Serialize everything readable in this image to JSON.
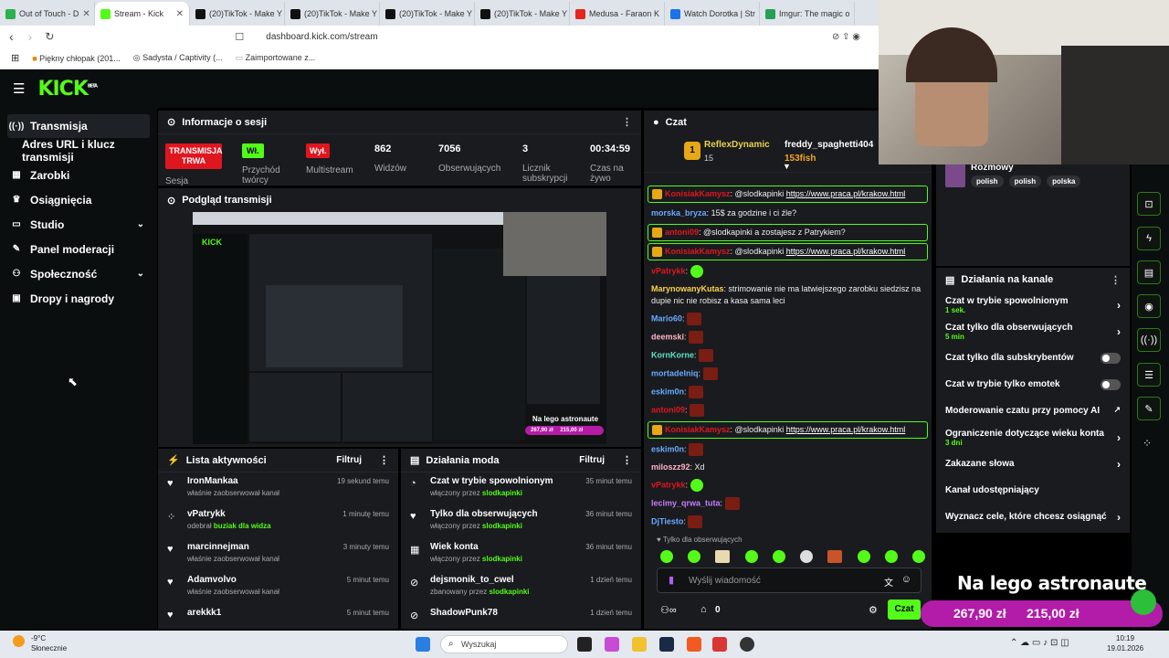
{
  "browser": {
    "tabs": [
      {
        "label": "Out of Touch - D",
        "color": "#2bb24c"
      },
      {
        "label": "Stream - Kick",
        "color": "#53fc18"
      },
      {
        "label": "(20)TikTok - Make Y",
        "color": "#111111"
      },
      {
        "label": "(20)TikTok - Make Y",
        "color": "#111111"
      },
      {
        "label": "(20)TikTok - Make Y",
        "color": "#111111"
      },
      {
        "label": "(20)TikTok - Make Y",
        "color": "#111111"
      },
      {
        "label": "Medusa - Faraon K",
        "color": "#e3261f"
      },
      {
        "label": "Watch Dorotka | Str",
        "color": "#1a73e8"
      },
      {
        "label": "Imgur: The magic o",
        "color": "#25a055"
      }
    ],
    "url": "dashboard.kick.com/stream",
    "bookmarks": [
      "Piękny chłopak (201...",
      "Sadysta / Captivity (...",
      "Zaimportowane z..."
    ]
  },
  "sidebar": {
    "items": [
      {
        "label": "Transmisja",
        "icon": "broadcast-icon"
      },
      {
        "label": "Adres URL i klucz transmisji",
        "icon": ""
      },
      {
        "label": "Zarobki",
        "icon": "chart-icon"
      },
      {
        "label": "Osiągnięcia",
        "icon": "trophy-icon"
      },
      {
        "label": "Studio",
        "icon": "studio-icon"
      },
      {
        "label": "Panel moderacji",
        "icon": "wrench-icon"
      },
      {
        "label": "Społeczność",
        "icon": "people-icon"
      },
      {
        "label": "Dropy i nagrody",
        "icon": "gift-icon"
      }
    ]
  },
  "session": {
    "title": "Informacje o sesji",
    "status_badge": "TRANSMISJA TRWA",
    "session_label": "Sesja",
    "forward_badge": "Wł.",
    "forward_label": "Przychód twórcy",
    "multistream_badge": "Wył.",
    "multistream_label": "Multistream",
    "viewers_value": "862",
    "viewers_label": "Widzów",
    "followers_value": "7056",
    "followers_label": "Obserwujących",
    "subs_value": "3",
    "subs_label": "Licznik subskrypcji",
    "time_value": "00:34:59",
    "time_label": "Czas na żywo"
  },
  "preview": {
    "title": "Podgląd transmisji",
    "overlay_text": "Na lego astronaute",
    "overlay_amount1": "267,90 zł",
    "overlay_amount2": "215,00 zł"
  },
  "activity": {
    "title": "Lista aktywności",
    "filter": "Filtruj",
    "rows": [
      {
        "name": "IronMankaa",
        "sub": "właśnie zaobserwował kanał",
        "highlight": "",
        "time": "19 sekund temu",
        "icon": "heart-icon"
      },
      {
        "name": "vPatrykk",
        "sub": "odebrał ",
        "highlight": "buziak dla widza",
        "time": "1 minutę temu",
        "icon": "reward-icon"
      },
      {
        "name": "marcinnejman",
        "sub": "właśnie zaobserwował kanał",
        "highlight": "",
        "time": "3 minuty temu",
        "icon": "heart-icon"
      },
      {
        "name": "Adamvolvo",
        "sub": "właśnie zaobserwował kanał",
        "highlight": "",
        "time": "5 minut temu",
        "icon": "heart-icon"
      },
      {
        "name": "arekkk1",
        "sub": "",
        "highlight": "",
        "time": "5 minut temu",
        "icon": "heart-icon"
      }
    ]
  },
  "modactions": {
    "title": "Działania moda",
    "filter": "Filtruj",
    "rows": [
      {
        "name": "Czat w trybie spowolnionym",
        "sub": "włączony przez ",
        "highlight": "slodkapinki",
        "time": "35 minut temu",
        "icon": "slow-icon"
      },
      {
        "name": "Tylko dla obserwujących",
        "sub": "włączony przez ",
        "highlight": "slodkapinki",
        "time": "36 minut temu",
        "icon": "heart-icon"
      },
      {
        "name": "Wiek konta",
        "sub": "włączony przez ",
        "highlight": "slodkapinki",
        "time": "36 minut temu",
        "icon": "calendar-icon"
      },
      {
        "name": "dejsmonik_to_cwel",
        "sub": "zbanowany przez ",
        "highlight": "slodkapinki",
        "time": "1 dzień temu",
        "icon": "ban-icon"
      },
      {
        "name": "ShadowPunk78",
        "sub": "",
        "highlight": "",
        "time": "1 dzień temu",
        "icon": "ban-icon"
      }
    ]
  },
  "chat": {
    "title": "Czat",
    "top_gifter_name": "ReflexDynamic",
    "top_gifter_count": "15",
    "top_gifter2_name": "freddy_spaghetti404",
    "top_gifter3_name": "153fish",
    "messages": [
      {
        "user": "KonisiakKamysz",
        "color": "#e0161f",
        "text": "@slodkapinki ",
        "link": "https://www.praca.pl/krakow.html",
        "hl": true,
        "emotes": 0
      },
      {
        "user": "morska_bryza",
        "color": "#6aa9ff",
        "text": "15$ za godzine i ci źle?",
        "link": "",
        "hl": false,
        "emotes": 0
      },
      {
        "user": "antoni09",
        "color": "#e0161f",
        "text": "@slodkapinki a zostajesz z Patrykiem?",
        "link": "",
        "hl": true,
        "emotes": 0
      },
      {
        "user": "KonisiakKamysz",
        "color": "#e0161f",
        "text": "@slodkapinki ",
        "link": "https://www.praca.pl/krakow.html",
        "hl": true,
        "emotes": 0
      },
      {
        "user": "vPatrykk",
        "color": "#e0161f",
        "text": "",
        "link": "",
        "hl": false,
        "emotes": 1,
        "green": true
      },
      {
        "user": "MarynowanyKutas",
        "color": "#ffd24a",
        "text": "strimowanie nie ma latwiejszego zarobku siedzisz na dupie nic nie robisz a kasa sama leci",
        "link": "",
        "hl": false,
        "emotes": 0
      },
      {
        "user": "Mario60",
        "color": "#6aa9ff",
        "text": "",
        "link": "",
        "hl": false,
        "emotes": 1
      },
      {
        "user": "deemski",
        "color": "#ffb3c7",
        "text": "",
        "link": "",
        "hl": false,
        "emotes": 1
      },
      {
        "user": "KornKorne",
        "color": "#5ee0c8",
        "text": "",
        "link": "",
        "hl": false,
        "emotes": 1
      },
      {
        "user": "mortadelniq",
        "color": "#6aa9ff",
        "text": "",
        "link": "",
        "hl": false,
        "emotes": 1
      },
      {
        "user": "eskim0n",
        "color": "#6aa9ff",
        "text": "",
        "link": "",
        "hl": false,
        "emotes": 1
      },
      {
        "user": "antoni09",
        "color": "#e0161f",
        "text": "",
        "link": "",
        "hl": false,
        "emotes": 1
      },
      {
        "user": "KonisiakKamysz",
        "color": "#e0161f",
        "text": "@slodkapinki ",
        "link": "https://www.praca.pl/krakow.html",
        "hl": true,
        "emotes": 0
      },
      {
        "user": "eskim0n",
        "color": "#6aa9ff",
        "text": "",
        "link": "",
        "hl": false,
        "emotes": 1
      },
      {
        "user": "miloszz92",
        "color": "#ffb3c7",
        "text": "Xd",
        "link": "",
        "hl": false,
        "emotes": 0
      },
      {
        "user": "vPatrykk",
        "color": "#e0161f",
        "text": "",
        "link": "",
        "hl": false,
        "emotes": 1,
        "green": true
      },
      {
        "user": "lecimy_qrwa_tuta",
        "color": "#c77dff",
        "text": "",
        "link": "",
        "hl": false,
        "emotes": 1
      },
      {
        "user": "DjTiesto",
        "color": "#6aa9ff",
        "text": "",
        "link": "",
        "hl": false,
        "emotes": 1
      }
    ],
    "followers_only_note": "Tylko dla obserwujących",
    "input_placeholder": "Wyślij wiadomość",
    "points": "0",
    "send_label": "Czat"
  },
  "tags": [
    "polish",
    "polish",
    "polska"
  ],
  "category": "Rozmowy",
  "channel_actions": {
    "title": "Działania na kanale",
    "rows": [
      {
        "label": "Czat w trybie spowolnionym",
        "sub": "1 sek.",
        "kind": "arrow"
      },
      {
        "label": "Czat tylko dla obserwujących",
        "sub": "5 min",
        "kind": "arrow"
      },
      {
        "label": "Czat tylko dla subskrybentów",
        "sub": "",
        "kind": "toggle"
      },
      {
        "label": "Czat w trybie tylko emotek",
        "sub": "",
        "kind": "toggle"
      },
      {
        "label": "Moderowanie czatu przy pomocy AI",
        "sub": "",
        "kind": "external"
      },
      {
        "label": "Ograniczenie dotyczące wieku konta",
        "sub": "3 dni",
        "kind": "arrow"
      },
      {
        "label": "Zakazane słowa",
        "sub": "",
        "kind": "arrow"
      },
      {
        "label": "Kanał udostępniający",
        "sub": "",
        "kind": "none"
      },
      {
        "label": "Wyznacz cele, które chcesz osiągnąć",
        "sub": "",
        "kind": "arrow"
      }
    ]
  },
  "overlay": {
    "text": "Na lego astronaute",
    "amount1": "267,90 zł",
    "amount2": "215,00 zł"
  },
  "taskbar": {
    "weather_temp": "-9°C",
    "weather_desc": "Słonecznie",
    "search": "Wyszukaj",
    "time": "10:19",
    "date": "19.01.2026"
  },
  "colors": {
    "kick_green": "#53fc18",
    "live_red": "#e0161f",
    "panel": "#191b1f",
    "bg": "#0b0e0f"
  }
}
